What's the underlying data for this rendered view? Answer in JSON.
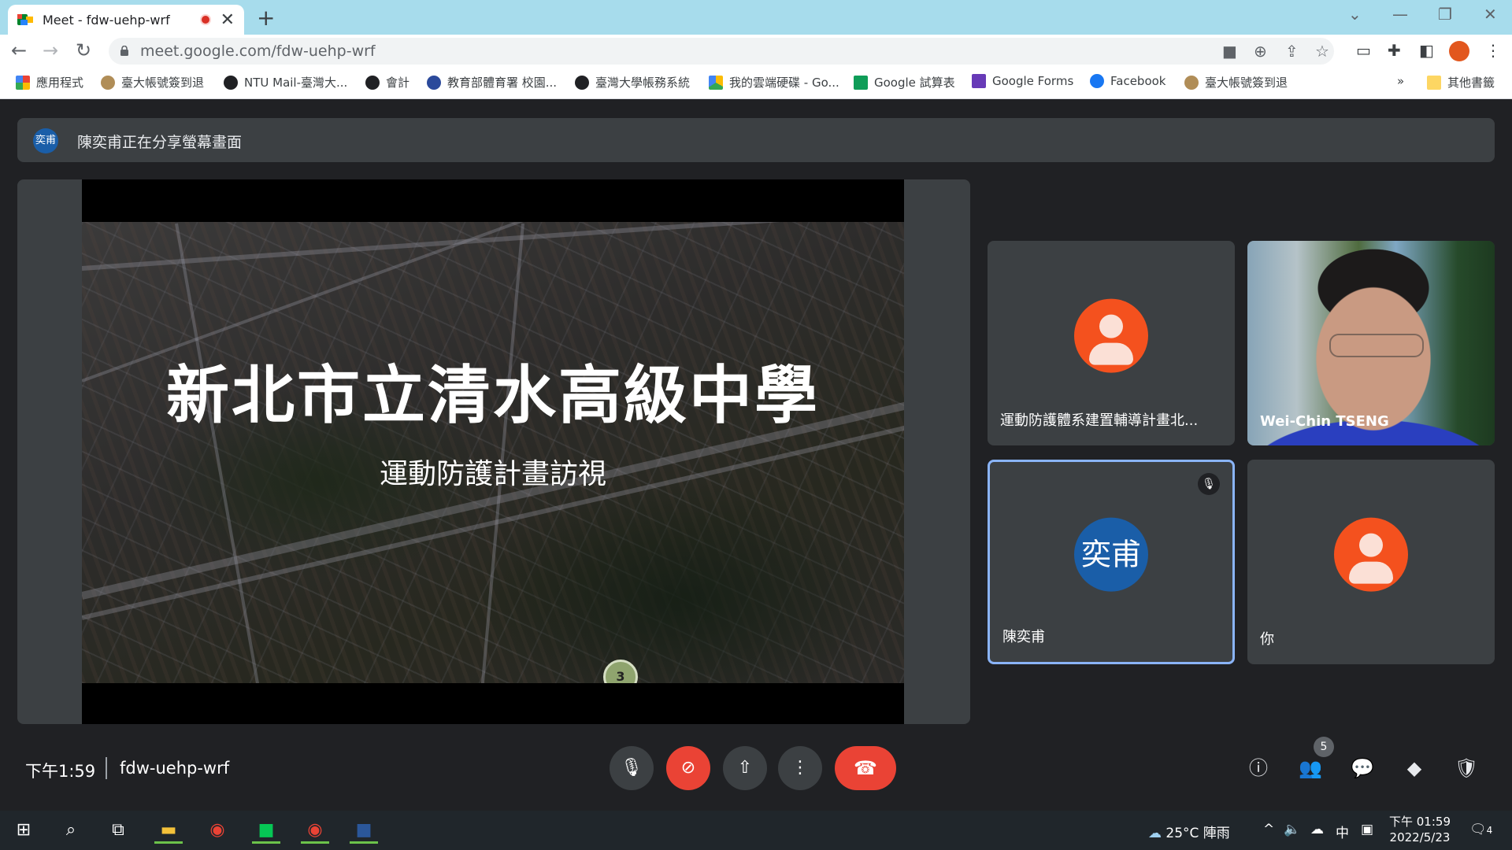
{
  "browser": {
    "tab_title": "Meet - fdw-uehp-wrf",
    "url": "meet.google.com/fdw-uehp-wrf",
    "bookmarks": [
      "應用程式",
      "臺大帳號簽到退",
      "NTU Mail-臺灣大...",
      "會計",
      "教育部體育署 校園...",
      "臺灣大學帳務系統",
      "我的雲端硬碟 - Go...",
      "Google 試算表",
      "Google Forms",
      "Facebook",
      "臺大帳號簽到退"
    ],
    "other_bookmarks": "其他書籤",
    "more_bookmarks": "»"
  },
  "meet": {
    "presenter_initials": "奕甫",
    "presenting_text": "陳奕甫正在分享螢幕畫面",
    "slide": {
      "title": "新北市立清水高級中學",
      "subtitle": "運動防護計畫訪視",
      "route_marker": "3"
    },
    "participants": [
      {
        "name": "運動防護體系建置輔導計畫北...",
        "type": "avatar-person"
      },
      {
        "name": "Wei-Chin TSENG",
        "type": "video"
      },
      {
        "name": "陳奕甫",
        "type": "avatar-initials",
        "initials": "奕甫",
        "muted": true,
        "active": true
      },
      {
        "name": "你",
        "type": "avatar-person"
      }
    ],
    "time": "下午1:59",
    "meeting_code": "fdw-uehp-wrf",
    "people_count": "5"
  },
  "taskbar": {
    "weather": "25°C  陣雨",
    "ime": "中",
    "clock_line1": "下午 01:59",
    "clock_line2": "2022/5/23",
    "notifications": "4"
  },
  "colors": {
    "meet_bg": "#202124",
    "tile_bg": "#3c4043",
    "accent_red": "#ea4335",
    "active_border": "#8ab4f8",
    "avatar_orange": "#f4511e",
    "avatar_blue": "#1a5ea8"
  }
}
